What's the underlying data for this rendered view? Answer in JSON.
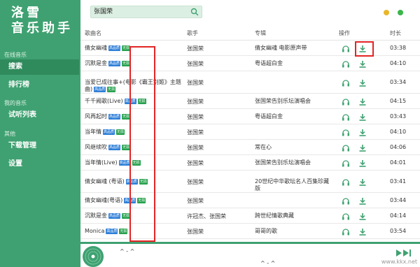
{
  "sidebar": {
    "logo_line1": "洛雪",
    "logo_line2": "音乐助手",
    "section_online": "在线音乐",
    "nav_search": "搜索",
    "nav_charts": "排行榜",
    "section_mine": "我的音乐",
    "nav_trial": "试听列表",
    "section_other": "其他",
    "nav_download": "下载管理",
    "nav_settings": "设置"
  },
  "search": {
    "value": "张国荣"
  },
  "window_controls": {
    "yellow": "#e9b62a",
    "green": "#3bb54a"
  },
  "table": {
    "headers": {
      "name": "歌曲名",
      "artist": "歌手",
      "album": "专辑",
      "ops": "操作",
      "duration": "时长"
    },
    "rows": [
      {
        "name": "倩女幽魂",
        "tags": [
          "高品质",
          "无损"
        ],
        "artist": "张国荣",
        "album": "倩女幽魂 电影原声带",
        "duration": "03:38"
      },
      {
        "name": "沉默是金",
        "tags": [
          "高品质",
          "无损"
        ],
        "artist": "张国荣",
        "album": "粤语超白金",
        "duration": "04:10"
      },
      {
        "name": "当爱已成往事+(电影《霸王别姬》主题曲)",
        "tags": [
          "高品质",
          "无损"
        ],
        "artist": "张国荣",
        "album": "",
        "duration": "03:34"
      },
      {
        "name": "千千阙歌(Live)",
        "tags": [
          "高品质",
          "无损"
        ],
        "artist": "张国荣",
        "album": "张国荣告别乐坛演唱会",
        "duration": "04:15"
      },
      {
        "name": "风再起时",
        "tags": [
          "高品质",
          "无损"
        ],
        "artist": "张国荣",
        "album": "粤语超白金",
        "duration": "03:43"
      },
      {
        "name": "当年情",
        "tags": [
          "高品质",
          "无损"
        ],
        "artist": "张国荣",
        "album": "",
        "duration": "04:10"
      },
      {
        "name": "风继续吹",
        "tags": [
          "高品质",
          "无损"
        ],
        "artist": "张国荣",
        "album": "常在心",
        "duration": "04:06"
      },
      {
        "name": "当年情(Live)",
        "tags": [
          "高品质",
          "无损"
        ],
        "artist": "张国荣",
        "album": "张国荣告别乐坛演唱会",
        "duration": "04:01"
      },
      {
        "name": "倩女幽魂 (粤语)",
        "tags": [
          "高品质",
          "无损"
        ],
        "artist": "张国荣",
        "album": "20世纪中华歌坛名人百集珍藏版",
        "duration": "03:41"
      },
      {
        "name": "倩女幽魂(粤语)",
        "tags": [
          "高品质",
          "无损"
        ],
        "artist": "张国荣",
        "album": "",
        "duration": "03:44"
      },
      {
        "name": "沉默是金",
        "tags": [
          "高品质",
          "无损"
        ],
        "artist": "许冠杰、张国荣",
        "album": "跨世纪情歌典藏",
        "duration": "04:14"
      },
      {
        "name": "Monica",
        "tags": [
          "高品质",
          "无损"
        ],
        "artist": "张国荣",
        "album": "哥哥的歌",
        "duration": "03:54"
      }
    ]
  },
  "player": {
    "song": "^ - ^",
    "progress_text": "^ - ^",
    "brand_color": "#3fa171"
  },
  "watermark": "www.kkx.net"
}
